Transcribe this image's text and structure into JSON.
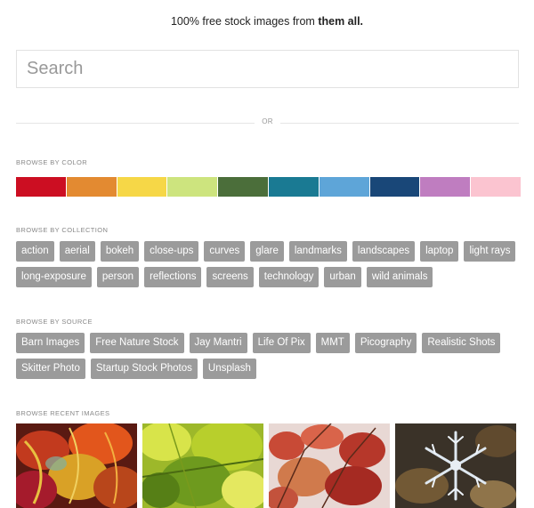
{
  "header": {
    "tagline_prefix": "100% free stock images from ",
    "tagline_emphasis": "them all."
  },
  "search": {
    "placeholder": "Search",
    "value": ""
  },
  "divider": {
    "label": "OR"
  },
  "browse_by_color": {
    "label": "BROWSE BY COLOR",
    "swatches": [
      "#cc0e22",
      "#e38a31",
      "#f6d747",
      "#cde47e",
      "#4b6e3a",
      "#1a7a93",
      "#5ea5d8",
      "#194778",
      "#bf7dc0",
      "#fbc4d0"
    ]
  },
  "browse_by_collection": {
    "label": "BROWSE BY COLLECTION",
    "items": [
      "action",
      "aerial",
      "bokeh",
      "close-ups",
      "curves",
      "glare",
      "landmarks",
      "landscapes",
      "laptop",
      "light rays",
      "long-exposure",
      "person",
      "reflections",
      "screens",
      "technology",
      "urban",
      "wild animals"
    ]
  },
  "browse_by_source": {
    "label": "BROWSE BY SOURCE",
    "items": [
      "Barn Images",
      "Free Nature Stock",
      "Jay Mantri",
      "Life Of Pix",
      "MMT",
      "Picography",
      "Realistic Shots",
      "Skitter Photo",
      "Startup Stock Photos",
      "Unsplash"
    ]
  },
  "browse_recent": {
    "label": "BROWSE RECENT IMAGES",
    "images": [
      "colorful-leaves-icon",
      "yellow-green-leaves-icon",
      "red-autumn-leaves-icon",
      "snowflake-ornament-icon"
    ]
  },
  "colors": {
    "tag_bg": "#9b9b9b",
    "tag_text": "#ffffff",
    "label_text": "#888888"
  }
}
